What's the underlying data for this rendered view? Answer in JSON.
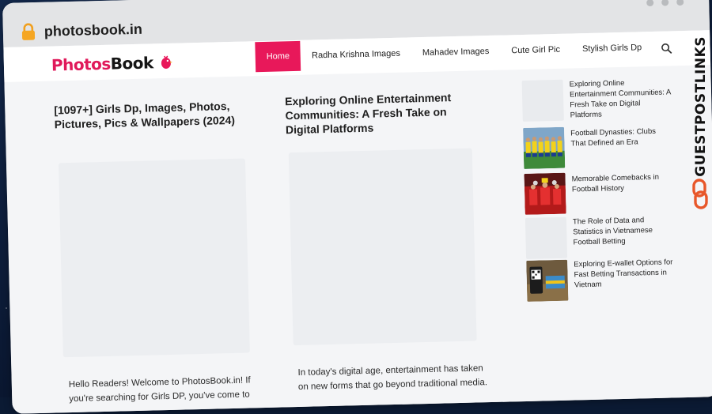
{
  "browser": {
    "url": "photosbook.in"
  },
  "site": {
    "logo_part1": "Photos",
    "logo_part2": "Book",
    "brand_color": "#e8185a"
  },
  "nav": {
    "items": [
      "Home",
      "Radha Krishna Images",
      "Mahadev Images",
      "Cute Girl Pic",
      "Stylish Girls Dp"
    ],
    "active": "Home"
  },
  "posts": [
    {
      "title": "[1097+] Girls Dp, Images, Photos, Pictures, Pics & Wallpapers (2024)",
      "excerpt": "Hello Readers! Welcome to PhotosBook.in! If you're searching for Girls DP, you've come to"
    },
    {
      "title": "Exploring Online Entertainment Communities: A Fresh Take on Digital Platforms",
      "excerpt": "In today's digital age, entertainment has taken on new forms that go beyond traditional media."
    }
  ],
  "sidebar": {
    "items": [
      {
        "title": "Exploring Online Entertainment Communities: A Fresh Take on Digital Platforms",
        "thumb": "blank"
      },
      {
        "title": "Football Dynasties: Clubs That Defined an Era",
        "thumb": "football-team-photo"
      },
      {
        "title": "Memorable Comebacks in Football History",
        "thumb": "red-team-celebration"
      },
      {
        "title": "The Role of Data and Statistics in Vietnamese Football Betting",
        "thumb": "blank"
      },
      {
        "title": "Exploring E-wallet Options for Fast Betting Transactions in Vietnam",
        "thumb": "phone-qr-payment"
      }
    ]
  },
  "watermark": {
    "text": "GUESTPOSTLINKS",
    "accent": "#e8572a"
  }
}
